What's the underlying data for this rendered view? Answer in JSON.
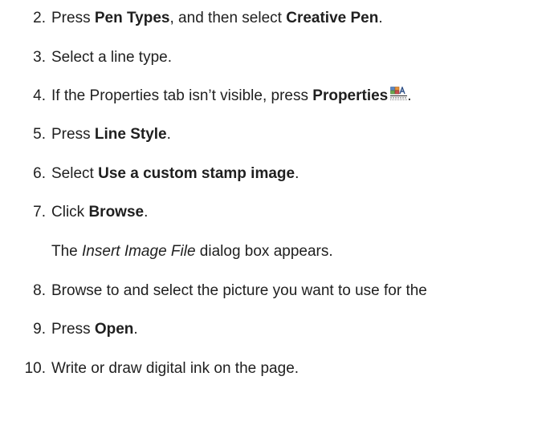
{
  "steps": [
    {
      "number": "2.",
      "parts": [
        {
          "text": "Press ",
          "bold": false
        },
        {
          "text": "Pen Types",
          "bold": true
        },
        {
          "text": ", and then select ",
          "bold": false
        },
        {
          "text": "Creative Pen",
          "bold": true
        },
        {
          "text": ".",
          "bold": false
        }
      ]
    },
    {
      "number": "3.",
      "parts": [
        {
          "text": "Select a line type.",
          "bold": false
        }
      ]
    },
    {
      "number": "4.",
      "parts": [
        {
          "text": "If the Properties tab isn’t visible, press ",
          "bold": false
        },
        {
          "text": "Properties",
          "bold": true
        }
      ],
      "icon": "properties-icon",
      "after_icon": "."
    },
    {
      "number": "5.",
      "parts": [
        {
          "text": "Press ",
          "bold": false
        },
        {
          "text": "Line Style",
          "bold": true
        },
        {
          "text": ".",
          "bold": false
        }
      ]
    },
    {
      "number": "6.",
      "parts": [
        {
          "text": "Select ",
          "bold": false
        },
        {
          "text": "Use a custom stamp image",
          "bold": true
        },
        {
          "text": ".",
          "bold": false
        }
      ]
    },
    {
      "number": "7.",
      "parts": [
        {
          "text": "Click ",
          "bold": false
        },
        {
          "text": "Browse",
          "bold": true
        },
        {
          "text": ".",
          "bold": false
        }
      ]
    },
    {
      "number": "8.",
      "parts": [
        {
          "text": "Browse to and select the picture you want to use for the",
          "bold": false
        }
      ]
    },
    {
      "number": "9.",
      "parts": [
        {
          "text": "Press ",
          "bold": false
        },
        {
          "text": "Open",
          "bold": true
        },
        {
          "text": ".",
          "bold": false
        }
      ]
    },
    {
      "number": "10.",
      "parts": [
        {
          "text": "Write or draw digital ink on the page.",
          "bold": false
        }
      ]
    }
  ],
  "note": {
    "prefix": "The ",
    "italic": "Insert Image File",
    "suffix": " dialog box appears."
  },
  "colors": {
    "text": "#1f1f1f",
    "icon_blue": "#5b87c4",
    "icon_orange": "#e8923a",
    "icon_green": "#6aa84f"
  }
}
